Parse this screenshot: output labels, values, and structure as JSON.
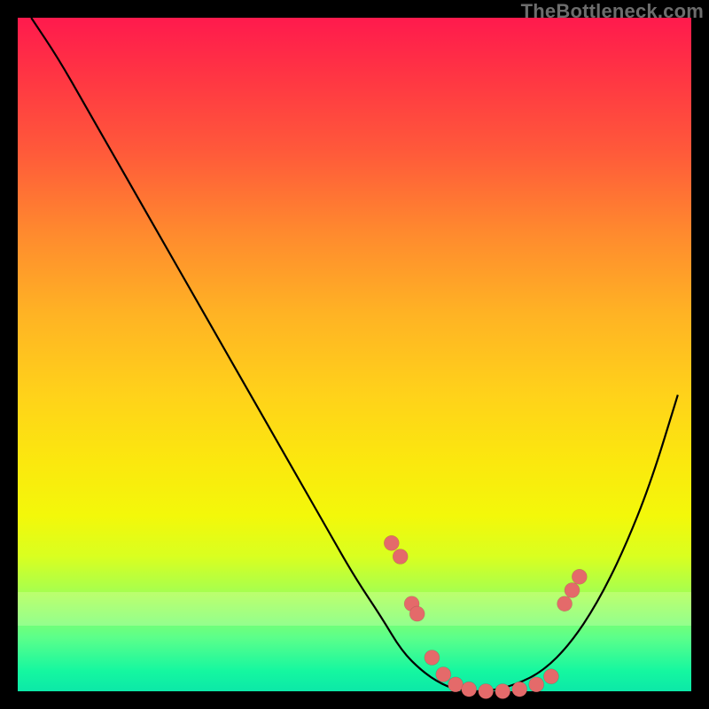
{
  "watermark": "TheBottleneck.com",
  "colors": {
    "gradient_top": "#ff1a4d",
    "gradient_bottom": "#0ce8a8",
    "curve": "#000000",
    "dots": "#e46a6a",
    "frame": "#000000"
  },
  "chart_data": {
    "type": "line",
    "title": "",
    "xlabel": "",
    "ylabel": "",
    "xlim": [
      0,
      100
    ],
    "ylim": [
      0,
      100
    ],
    "grid": false,
    "legend": false,
    "series": [
      {
        "name": "bottleneck-curve",
        "x": [
          2,
          6,
          10,
          14,
          18,
          22,
          26,
          30,
          34,
          38,
          42,
          46,
          50,
          54,
          57,
          60,
          63,
          66,
          70,
          74,
          78,
          82,
          86,
          90,
          94,
          98
        ],
        "y": [
          100,
          94,
          87,
          80,
          73,
          66,
          59,
          52,
          45,
          38,
          31,
          24,
          17,
          11,
          6,
          3,
          1,
          0,
          0,
          1,
          3,
          7,
          13,
          21,
          31,
          44
        ]
      }
    ],
    "scatter": {
      "name": "sample-points",
      "x": [
        55.5,
        56.8,
        58.5,
        59.3,
        61.5,
        63.2,
        65.0,
        67.0,
        69.5,
        72.0,
        74.5,
        77.0,
        79.2,
        81.2,
        82.3,
        83.4
      ],
      "y": [
        22.0,
        20.0,
        13.0,
        11.5,
        5.0,
        2.5,
        1.0,
        0.3,
        0.0,
        0.0,
        0.3,
        1.0,
        2.2,
        13.0,
        15.0,
        17.0
      ]
    }
  }
}
